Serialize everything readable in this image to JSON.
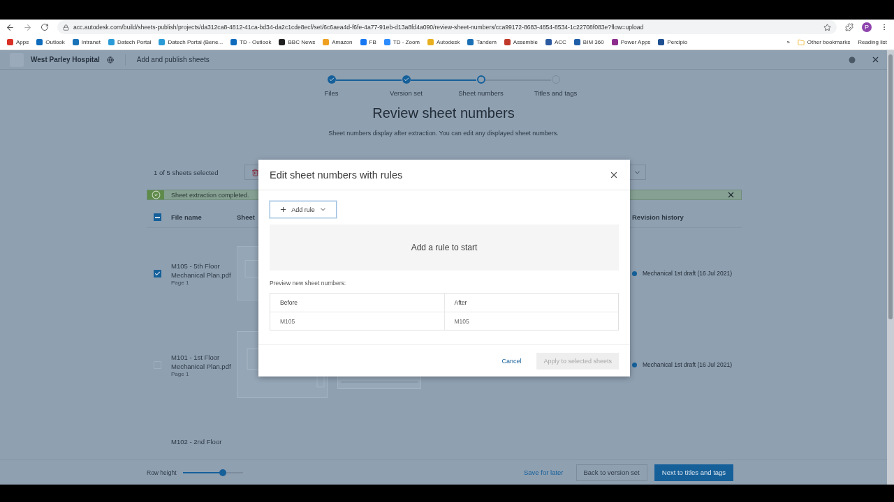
{
  "browser": {
    "url": "acc.autodesk.com/build/sheets-publish/projects/da312ca8-4812-41ca-bd34-da2c1cde8ecf/set/6c6aea4d-f6fe-4a77-91eb-d13a8fd4a090/review-sheet-numbers/cca99172-8683-4854-8534-1c22708f083e?flow=upload",
    "profile": "P",
    "bookmarks": [
      {
        "label": "Apps",
        "color": "#d93025"
      },
      {
        "label": "Outlook",
        "color": "#0f6cbd"
      },
      {
        "label": "Intranet",
        "color": "#1a73b8"
      },
      {
        "label": "Datech Portal",
        "color": "#2a9bd6"
      },
      {
        "label": "Datech Portal (Bene...",
        "color": "#2a9bd6"
      },
      {
        "label": "TD - Outlook",
        "color": "#0f6cbd"
      },
      {
        "label": "BBC News",
        "color": "#202020"
      },
      {
        "label": "Amazon",
        "color": "#f0a020"
      },
      {
        "label": "FB",
        "color": "#1877f2"
      },
      {
        "label": "TD - Zoom",
        "color": "#2d8cff"
      },
      {
        "label": "Autodesk",
        "color": "#e8b020"
      },
      {
        "label": "Tandem",
        "color": "#1a6fb5"
      },
      {
        "label": "Assemble",
        "color": "#c0392b"
      },
      {
        "label": "ACC",
        "color": "#2c5aa0"
      },
      {
        "label": "BIM 360",
        "color": "#1f5fa8"
      },
      {
        "label": "Power Apps",
        "color": "#8e2d8e"
      },
      {
        "label": "Percipio",
        "color": "#1d4f91"
      }
    ],
    "more": "»",
    "other": "Other bookmarks",
    "reading": "Reading list"
  },
  "header": {
    "project": "West Parley Hospital",
    "page": "Add and publish sheets"
  },
  "steps": [
    {
      "label": "Files",
      "completed": true,
      "selected": false
    },
    {
      "label": "Version set",
      "completed": true,
      "selected": false
    },
    {
      "label": "Sheet numbers",
      "completed": false,
      "selected": true
    },
    {
      "label": "Titles and tags",
      "completed": false,
      "selected": false
    }
  ],
  "title": "Review sheet numbers",
  "subtitle": "Sheet numbers display after extraction. You can edit any displayed sheet numbers.",
  "selection": "1 of 5 sheets selected",
  "banner": "Sheet extraction completed.",
  "select_all_mixed": true,
  "columns": [
    "File name",
    "Sheet",
    "Revision history"
  ],
  "rows": [
    {
      "name": "M105 - 5th Floor Mechanical Plan.pdf",
      "page": "Page 1",
      "checked": true,
      "revision": "Mechanical 1st draft (16 Jul 2021)"
    },
    {
      "name": "M101 - 1st Floor Mechanical Plan.pdf",
      "page": "Page 1",
      "checked": false,
      "revision": "Mechanical 1st draft (16 Jul 2021)"
    },
    {
      "name": "M102 - 2nd Floor"
    }
  ],
  "footer": {
    "row_height": "Row height",
    "level": 0.66,
    "save": "Save for later",
    "back": "Back to version set",
    "next": "Next to titles and tags"
  },
  "dialog": {
    "title": "Edit sheet numbers with rules",
    "add_rule": "Add rule",
    "empty": "Add a rule to start",
    "preview": "Preview new sheet numbers:",
    "columns": [
      "Before",
      "After"
    ],
    "rows": [
      [
        "M105",
        "M105"
      ]
    ],
    "cancel": "Cancel",
    "apply": {
      "label": "Apply to selected sheets",
      "disabled": true
    }
  }
}
